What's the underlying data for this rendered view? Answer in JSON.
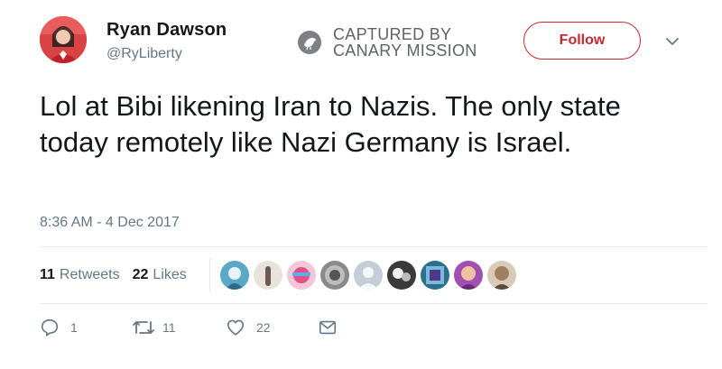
{
  "user": {
    "name": "Ryan Dawson",
    "handle": "@RyLiberty"
  },
  "watermark": {
    "line1": "CAPTURED BY",
    "line2": "CANARY MISSION"
  },
  "follow_label": "Follow",
  "tweet_text": "Lol at Bibi likening Iran to Nazis. The only state today remotely like Nazi Germany is Israel.",
  "timestamp": "8:36 AM - 4 Dec 2017",
  "stats": {
    "retweets_count": "11",
    "retweets_label": "Retweets",
    "likes_count": "22",
    "likes_label": "Likes"
  },
  "likers": [
    {
      "icon": "liker-avatar",
      "color": "#5aa7c7"
    },
    {
      "icon": "liker-avatar",
      "color": "#6b5a52"
    },
    {
      "icon": "liker-avatar",
      "color": "#f0a0c0"
    },
    {
      "icon": "liker-avatar",
      "color": "#8a8a8a"
    },
    {
      "icon": "default-avatar",
      "color": "#c5ced6"
    },
    {
      "icon": "liker-avatar",
      "color": "#3a3a3a"
    },
    {
      "icon": "liker-avatar",
      "color": "#2b6f8f"
    },
    {
      "icon": "liker-avatar",
      "color": "#a050b0"
    },
    {
      "icon": "liker-avatar",
      "color": "#a08060"
    }
  ],
  "actions": {
    "reply_count": "1",
    "retweet_count": "11",
    "like_count": "22"
  },
  "colors": {
    "follow_accent": "#c7282f",
    "secondary_text": "#657786"
  }
}
